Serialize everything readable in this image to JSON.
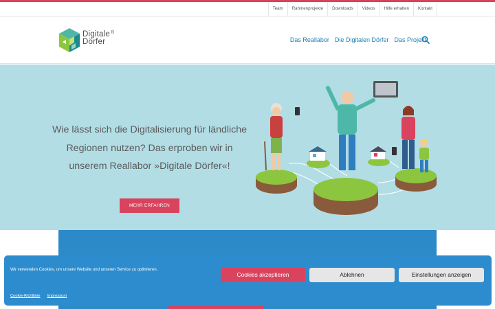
{
  "top_nav": [
    "Team",
    "Rahmenprojekte",
    "Downloads",
    "Videos",
    "Hilfe erhalten",
    "Kontakt"
  ],
  "logo": {
    "line1": "Digitale",
    "line2": "Dörfer",
    "mark": "®"
  },
  "main_nav": [
    "Das Reallabor",
    "Die Digitalen Dörfer",
    "Das Projekt"
  ],
  "hero": {
    "headline": "Wie lässt sich die Digitalisierung für ländliche Regionen nutzen? Das erproben wir in unserem Reallabor »Digitale Dörfer«!",
    "button": "MEHR ERFAHREN"
  },
  "cookie_banner": {
    "message": "Wir verwenden Cookies, um unsere Website und unseren Service zu optimieren.",
    "accept": "Cookies akzeptieren",
    "deny": "Ablehnen",
    "settings": "Einstellungen anzeigen",
    "links": [
      "Cookie-Richtlinie",
      "Impressum"
    ]
  },
  "colors": {
    "accent": "#d9435e",
    "link": "#1f7fb3",
    "hero_bg": "#b2dde5",
    "banner": "#2d8ccd"
  },
  "icons": [
    "search-icon"
  ]
}
